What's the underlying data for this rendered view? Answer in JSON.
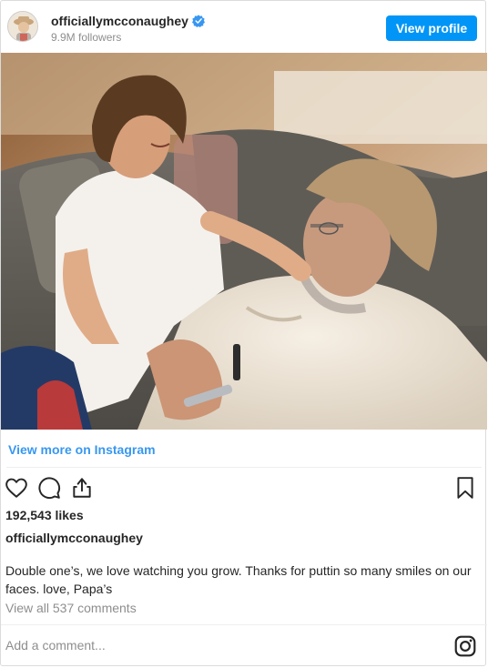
{
  "post": {
    "username": "officiallymcconaughey",
    "followers": "9.9M followers",
    "view_profile_label": "View profile",
    "view_more_label": "View more on Instagram",
    "likes": "192,543 likes",
    "caption_username": "officiallymcconaughey",
    "caption_text": "Double one’s, we love watching you grow. Thanks for puttin so many smiles on our faces. love, Papa’s",
    "view_comments": "View all 537 comments",
    "comment_placeholder": "Add a comment..."
  },
  "icons": {
    "verified": "verified-badge-icon",
    "like": "heart-icon",
    "comment": "speech-bubble-icon",
    "share": "share-icon",
    "save": "bookmark-icon",
    "instagram": "instagram-logo-icon"
  },
  "colors": {
    "accent": "#0095f6",
    "link": "#3897f0",
    "text": "#262626",
    "muted": "#8e8e8e",
    "border": "#dbdbdb"
  }
}
